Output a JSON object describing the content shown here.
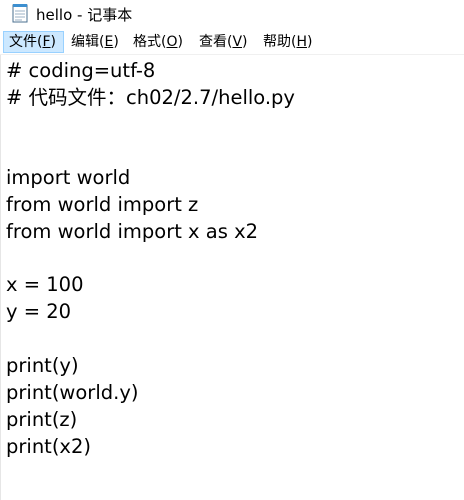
{
  "window": {
    "title": "hello - 记事本",
    "icon": "notepad-icon"
  },
  "menu": {
    "items": [
      {
        "label": "文件(",
        "hotkey": "F",
        "close": ")"
      },
      {
        "label": "编辑(",
        "hotkey": "E",
        "close": ")"
      },
      {
        "label": "格式(",
        "hotkey": "O",
        "close": ")"
      },
      {
        "label": "查看(",
        "hotkey": "V",
        "close": ")"
      },
      {
        "label": "帮助(",
        "hotkey": "H",
        "close": ")"
      }
    ],
    "active_index": 0
  },
  "editor": {
    "lines": [
      "# coding=utf-8",
      "# 代码文件：ch02/2.7/hello.py",
      "",
      "",
      "import world",
      "from world import z",
      "from world import x as x2",
      "",
      "x = 100",
      "y = 20",
      "",
      "print(y)",
      "print(world.y)",
      "print(z)",
      "print(x2)"
    ]
  },
  "colors": {
    "menu_active_bg": "#cce8ff",
    "menu_active_border": "#99d1ff"
  }
}
